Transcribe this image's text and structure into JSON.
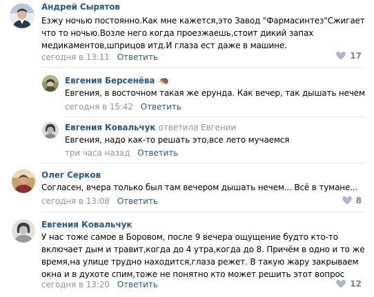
{
  "comments": [
    {
      "author": "Андрей Сырятов",
      "lines": [
        "Езжу ночью постоянно.Как мне кажется,это Завод \"Фармасинтез\"Сжигает",
        "что то ночью.Возле него когда проезжаешь,стоит дикий запах",
        "медикаментов,шприцов итд.И глаза ест даже в машине."
      ],
      "time": "сегодня в 13:11",
      "reply_label": "Ответить",
      "likes": "17",
      "avatar_colors": [
        "#6e7f95",
        "#e6ebf2",
        "#2f3a48"
      ]
    },
    {
      "author": "Евгения Берсенёва",
      "author_emoji": "🦔",
      "lines": [
        "Евгения, в восточном такая же ерунда. Как вечер, так дышать нечем"
      ],
      "time": "сегодня в 15:42",
      "reply_label": "Ответить",
      "avatar_colors": [
        "#8b9a6a",
        "#4a5a3a",
        "#c9b48a"
      ]
    },
    {
      "author": "Евгения Ковальчук",
      "author_extra": "ответила Евгении",
      "lines": [
        "Евгения, надо как-то решать это,все лето мучаемся"
      ],
      "time": "три часа назад",
      "reply_label": "Ответить",
      "avatar_colors": [
        "#d8d8d8",
        "#3a3a3a",
        "#8a8a8a"
      ]
    },
    {
      "author": "Олег Серков",
      "lines": [
        "Согласен, вчера только был там вечером дышать нечем... Всё в тумане..."
      ],
      "time": "сегодня в 13:08",
      "reply_label": "Ответить",
      "likes": "8",
      "avatar_colors": [
        "#c7a26a",
        "#8b2f2f",
        "#e8d9b8"
      ]
    },
    {
      "author": "Евгения Ковальчук",
      "lines": [
        "У нас тоже самое в Боровом, после 9 вечера ощущение будто кто-то",
        "включает дым и травит,когда до 4 утра,когда до 8. Причём в одно и то же",
        "время,на улице трудно находится,глаза режет. В такую жару закрываем",
        "окна и в духоте спим,тоже не понятно кто может решить этот вопрос"
      ],
      "time": "сегодня в 13:20",
      "reply_label": "Ответить",
      "likes": "12",
      "avatar_colors": [
        "#e2e2e2",
        "#404040",
        "#9a9a9a"
      ]
    }
  ],
  "colors": {
    "link": "#2a5885",
    "meta": "#939393",
    "like_count": "#828282",
    "divider": "#e7e8ec"
  },
  "icons": {
    "like": "heart-icon",
    "emoji": "hedgehog-emoji"
  }
}
